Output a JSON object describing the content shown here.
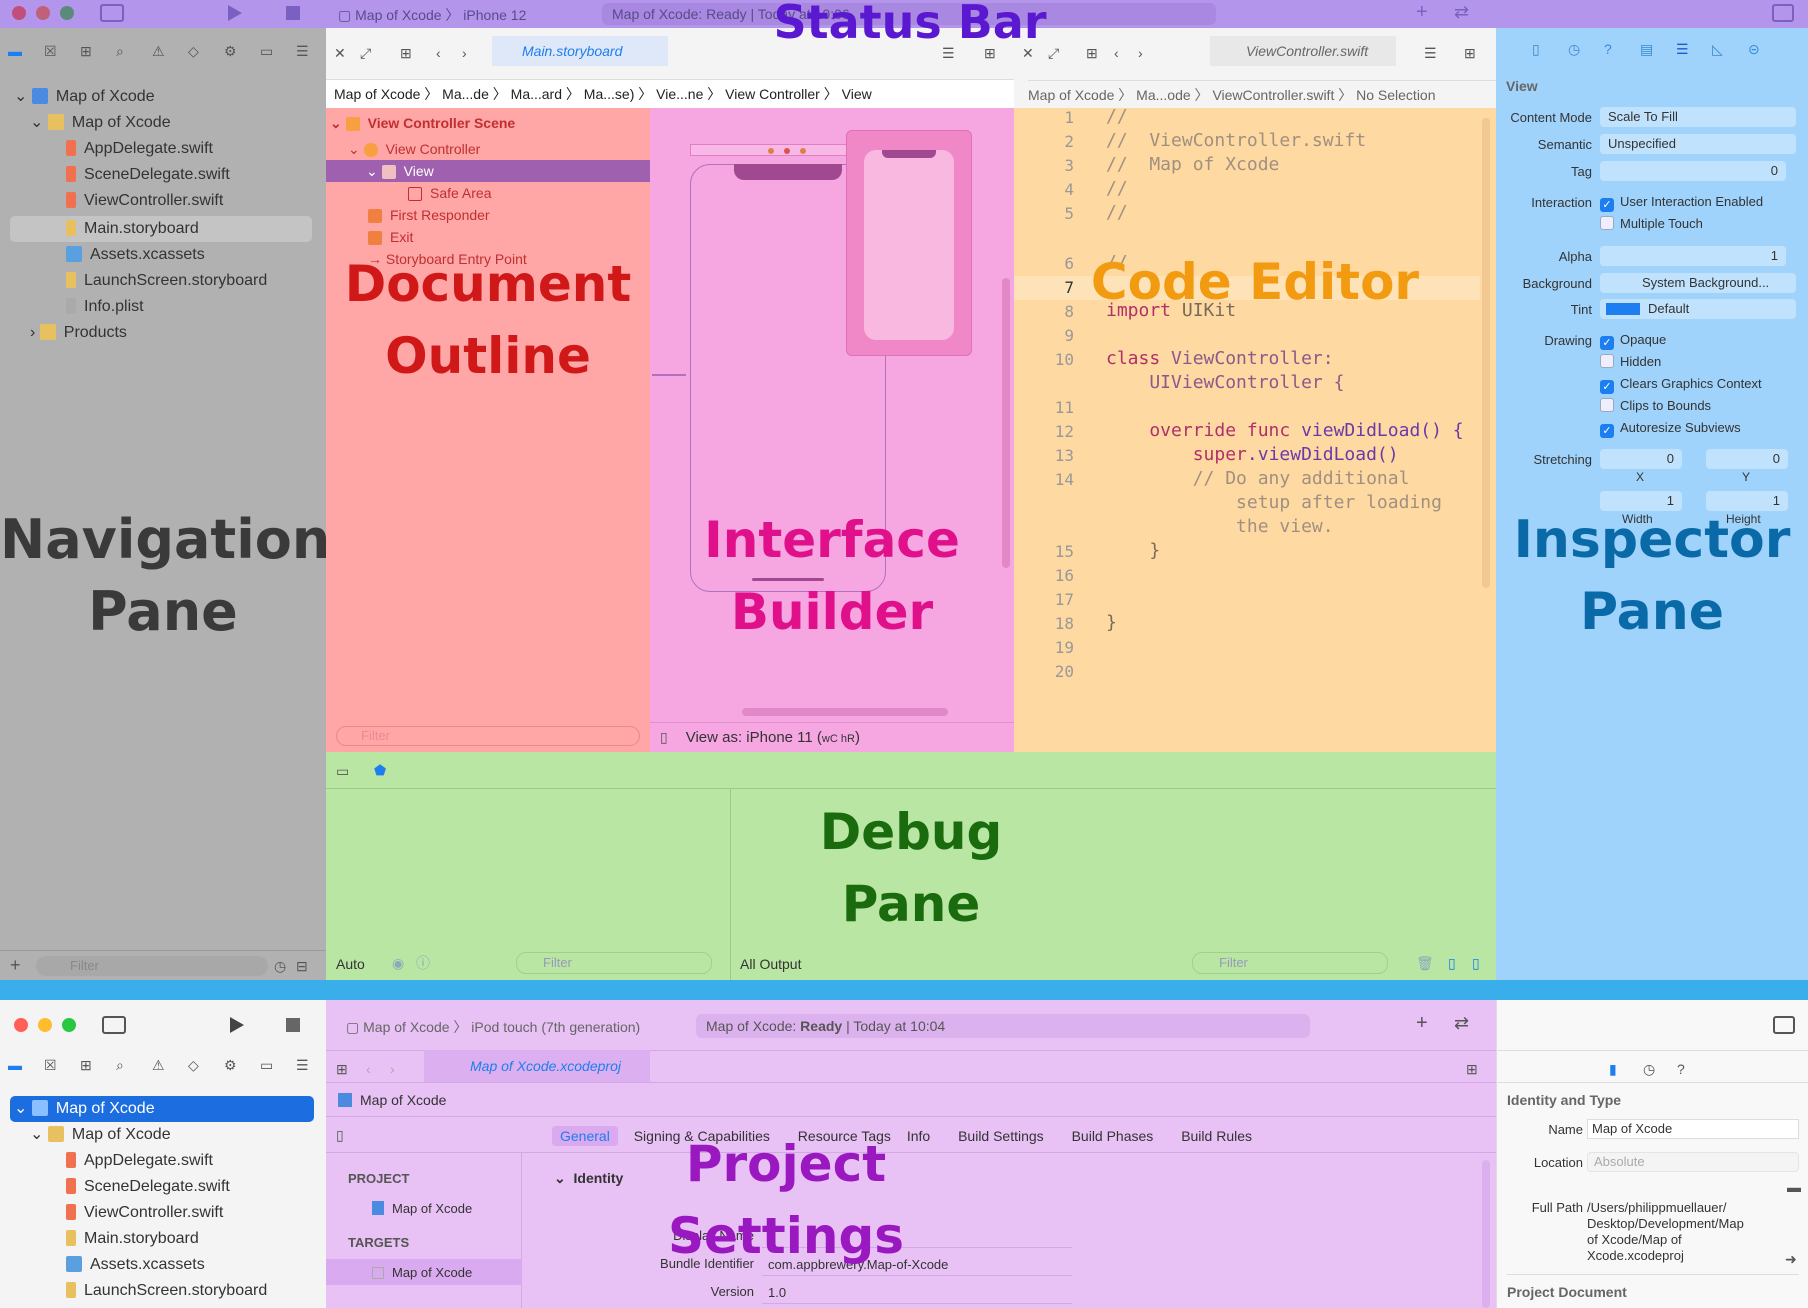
{
  "labels": {
    "status_bar": "Status Bar",
    "document_outline_1": "Document",
    "document_outline_2": "Outline",
    "navigation_1": "Navigation",
    "navigation_2": "Pane",
    "interface_builder_1": "Interface",
    "interface_builder_2": "Builder",
    "code_editor": "Code Editor",
    "inspector_1": "Inspector",
    "inspector_2": "Pane",
    "debug_1": "Debug",
    "debug_2": "Pane",
    "project_settings_1": "Project",
    "project_settings_2": "Settings"
  },
  "colors": {
    "navigation": "#b1b1b1",
    "status_bar": "#b495ec",
    "document_outline": "#ffa6a6",
    "interface_builder": "#f6a6e1",
    "code_editor": "#ffd9a2",
    "inspector": "#9fd3fc",
    "debug": "#b9e6a3",
    "project_settings": "#e8c1f5",
    "accent": "#1c7ef0"
  },
  "top": {
    "scheme": "Map of Xcode",
    "device": "iPhone 12",
    "status_text": "Map of Xcode: Ready | To",
    "status_time": "day at 10:06",
    "navigator": {
      "root": "Map of Xcode",
      "group": "Map of Xcode",
      "files": [
        "AppDelegate.swift",
        "SceneDelegate.swift",
        "ViewController.swift",
        "Main.storyboard",
        "Assets.xcassets",
        "LaunchScreen.storyboard",
        "Info.plist"
      ],
      "products": "Products",
      "filter_placeholder": "Filter"
    },
    "editor_left": {
      "tab": "Main.storyboard",
      "breadcrumb": [
        "Map of Xcode",
        "Ma...de",
        "Ma...ard",
        "Ma...se)",
        "Vie...ne",
        "View Controller",
        "View"
      ],
      "outline": {
        "scene": "View Controller Scene",
        "controller": "View Controller",
        "view": "View",
        "safe_area": "Safe Area",
        "first_responder": "First Responder",
        "exit": "Exit",
        "entry_point": "Storyboard Entry Point"
      },
      "filter_placeholder": "Filter",
      "view_as": "View as: iPhone 11 (",
      "view_as_traits": "wC hR",
      "view_as_end": ")"
    },
    "editor_right": {
      "tab": "ViewController.swift",
      "breadcrumb": [
        "Map of Xcode",
        "Ma...ode",
        "ViewController.swift",
        "No Selection"
      ],
      "line_numbers": [
        "1",
        "2",
        "3",
        "4",
        "5",
        "6",
        "7",
        "8",
        "9",
        "10",
        "11",
        "12",
        "13",
        "14",
        "15",
        "16",
        "17",
        "18",
        "19",
        "20"
      ],
      "lines": {
        "l1": "//",
        "l2": "//  ViewController.swift",
        "l3": "//  Map of Xcode",
        "l4": "//",
        "l5": "//",
        "l6": "//",
        "l8a": "import",
        "l8b": " UIKit",
        "l10a": "class",
        "l10b": " ViewController:",
        "l10c": "    UIViewController {",
        "l12a": "    override func",
        "l12b": " viewDidLoad() {",
        "l13a": "        super",
        "l13b": ".viewDidLoad()",
        "l14a": "        // Do any additional",
        "l14b": "            setup after loading",
        "l14c": "            the view.",
        "l15": "    }",
        "l18": "}"
      }
    },
    "inspector": {
      "section": "View",
      "content_mode_label": "Content Mode",
      "content_mode": "Scale To Fill",
      "semantic_label": "Semantic",
      "semantic": "Unspecified",
      "tag_label": "Tag",
      "tag": "0",
      "interaction_label": "Interaction",
      "user_interaction": "User Interaction Enabled",
      "multiple_touch": "Multiple Touch",
      "alpha_label": "Alpha",
      "alpha": "1",
      "background_label": "Background",
      "background": "System Background...",
      "tint_label": "Tint",
      "tint": "Default",
      "drawing_label": "Drawing",
      "opaque": "Opaque",
      "hidden": "Hidden",
      "clears": "Clears Graphics Context",
      "clips": "Clips to Bounds",
      "autoresize": "Autoresize Subviews",
      "stretching_label": "Stretching",
      "stretch_x": "0",
      "stretch_y": "0",
      "x_label": "X",
      "y_label": "Y",
      "stretch_w": "1",
      "stretch_h": "1",
      "width_label": "Width",
      "height_label": "Height"
    },
    "debug": {
      "auto": "Auto",
      "filter_placeholder": "Filter",
      "all_output": "All Output",
      "filter2_placeholder": "Filter"
    }
  },
  "bottom": {
    "scheme": "Map of Xcode",
    "device": "iPod touch (7th generation)",
    "status_text": "Map of Xcode: ",
    "status_bold": "Ready",
    "status_time": " | Today at 10:04",
    "navigator": {
      "root": "Map of Xcode",
      "group": "Map of Xcode",
      "files": [
        "AppDelegate.swift",
        "SceneDelegate.swift",
        "ViewController.swift",
        "Main.storyboard",
        "Assets.xcassets",
        "LaunchScreen.storyboard"
      ]
    },
    "editor": {
      "tab": "Map of Xcode.xcodeproj",
      "breadcrumb": "Map of Xcode",
      "tabs": [
        "General",
        "Signing & Capabilities",
        "Resource Tags",
        "Info",
        "Build Settings",
        "Build Phases",
        "Build Rules"
      ],
      "project_header": "PROJECT",
      "project_item": "Map of Xcode",
      "targets_header": "TARGETS",
      "target_item": "Map of Xcode",
      "identity": "Identity",
      "display_name_label": "Display Name",
      "bundle_label": "Bundle Identifier",
      "bundle_value": "com.appbrewery.Map-of-Xcode",
      "version_label": "Version",
      "version_value": "1.0"
    },
    "inspector": {
      "identity_type": "Identity and Type",
      "name_label": "Name",
      "name_value": "Map of Xcode",
      "location_label": "Location",
      "location_value": "Absolute",
      "full_path_label": "Full Path",
      "full_path_1": "/Users/philippmuellauer/",
      "full_path_2": "Desktop/Development/Map",
      "full_path_3": "of Xcode/Map of",
      "full_path_4": "Xcode.xcodeproj",
      "project_document": "Project Document"
    }
  }
}
